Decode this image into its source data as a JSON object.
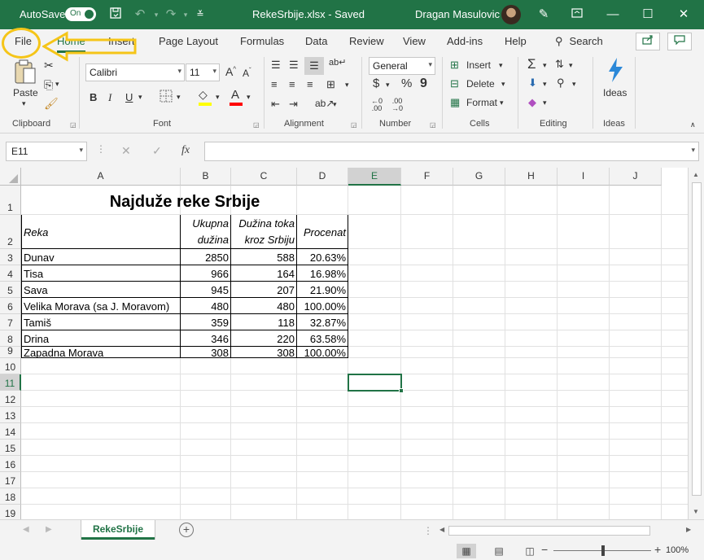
{
  "titlebar": {
    "autosave_label": "AutoSave",
    "autosave_state": "On",
    "doc_title": "RekeSrbije.xlsx  -  Saved",
    "user_name": "Dragan Masulovic",
    "bg_color": "#217346"
  },
  "menu": {
    "tabs": [
      "File",
      "Home",
      "Insert",
      "Page Layout",
      "Formulas",
      "Data",
      "Review",
      "View",
      "Add-ins",
      "Help"
    ],
    "active_tab": "Home",
    "search_label": "Search"
  },
  "ribbon": {
    "groups": [
      "Clipboard",
      "Font",
      "Alignment",
      "Number",
      "Cells",
      "Editing",
      "Ideas"
    ],
    "paste_label": "Paste",
    "font_name": "Calibri",
    "font_size": "11",
    "number_format": "General",
    "insert_label": "Insert",
    "delete_label": "Delete",
    "format_label": "Format",
    "ideas_label": "Ideas",
    "bold": "B",
    "italic": "I",
    "underline": "U",
    "grow_font": "A",
    "shrink_font": "A",
    "font_color_letter": "A",
    "currency": "$",
    "percent": "%",
    "comma": "9",
    "fill_color": "#ffff00",
    "font_color": "#ff0000"
  },
  "formula_bar": {
    "name_box": "E11",
    "fx": "fx",
    "content": ""
  },
  "grid": {
    "columns": [
      "A",
      "B",
      "C",
      "D",
      "E",
      "F",
      "G",
      "H",
      "I",
      "J"
    ],
    "rows": [
      "1",
      "2",
      "3",
      "4",
      "5",
      "6",
      "7",
      "8",
      "9",
      "10",
      "11",
      "12",
      "13",
      "14",
      "15",
      "16",
      "17",
      "18",
      "19"
    ],
    "selected_col": "E",
    "selected_row": "11"
  },
  "sheet": {
    "title": "Najduže reke Srbije",
    "headers": {
      "reka": "Reka",
      "ukupna_line1": "Ukupna",
      "ukupna_line2": "dužina",
      "kroz_line1": "Dužina toka",
      "kroz_line2": "kroz Srbiju",
      "procenat": "Procenat"
    },
    "data": [
      [
        "Dunav",
        "2850",
        "588",
        "20.63%"
      ],
      [
        "Tisa",
        "966",
        "164",
        "16.98%"
      ],
      [
        "Sava",
        "945",
        "207",
        "21.90%"
      ],
      [
        "Velika Morava (sa J. Moravom)",
        "480",
        "480",
        "100.00%"
      ],
      [
        "Tamiš",
        "359",
        "118",
        "32.87%"
      ],
      [
        "Drina",
        "346",
        "220",
        "63.58%"
      ],
      [
        "Zapadna Morava",
        "308",
        "308",
        "100.00%"
      ]
    ]
  },
  "tabs": {
    "sheet_name": "RekeSrbije",
    "add_sheet": "+"
  },
  "status": {
    "zoom": "100%",
    "zoom_minus": "−",
    "zoom_plus": "+"
  },
  "annotation": {
    "color": "#f5c518"
  }
}
